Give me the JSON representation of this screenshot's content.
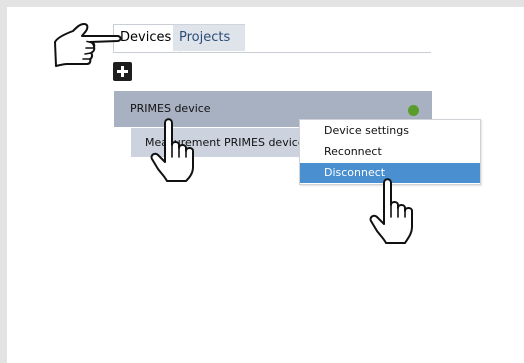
{
  "tabs": [
    {
      "label": "Devices",
      "active": true
    },
    {
      "label": "Projects",
      "active": false
    }
  ],
  "device": {
    "name": "PRIMES device",
    "status_color": "#5a9c2c"
  },
  "sub_item": {
    "label": "Measurement PRIMES device"
  },
  "context_menu": {
    "items": [
      {
        "label": "Device settings",
        "selected": false
      },
      {
        "label": "Reconnect",
        "selected": false
      },
      {
        "label": "Disconnect",
        "selected": true
      }
    ]
  },
  "colors": {
    "accent": "#4a8fcf",
    "device_row": "#a7b1c2",
    "sub_row": "#ccd3df",
    "status_ok": "#5a9c2c"
  },
  "icons": [
    "add-icon",
    "status-dot-icon",
    "pointing-hand-icon",
    "click-hand-icon"
  ]
}
